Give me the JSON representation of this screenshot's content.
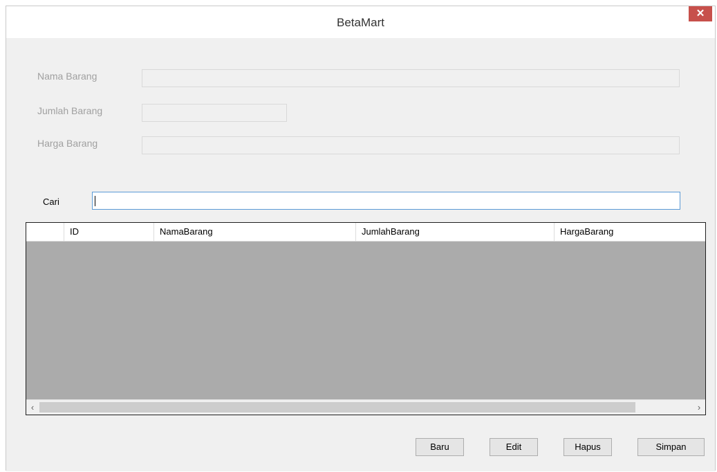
{
  "window": {
    "title": "BetaMart",
    "close_glyph": "✕"
  },
  "form": {
    "nama_label": "Nama Barang",
    "nama_value": "",
    "jumlah_label": "Jumlah Barang",
    "jumlah_value": "",
    "harga_label": "Harga Barang",
    "harga_value": ""
  },
  "search": {
    "label": "Cari",
    "value": ""
  },
  "grid": {
    "columns": [
      "ID",
      "NamaBarang",
      "JumlahBarang",
      "HargaBarang"
    ],
    "rows": [],
    "scroll_left": "‹",
    "scroll_right": "›"
  },
  "buttons": {
    "baru": "Baru",
    "edit": "Edit",
    "hapus": "Hapus",
    "simpan": "Simpan"
  },
  "colors": {
    "close_bg": "#c7504b",
    "grid_bg": "#ababab",
    "active_border": "#5a9ad6"
  }
}
